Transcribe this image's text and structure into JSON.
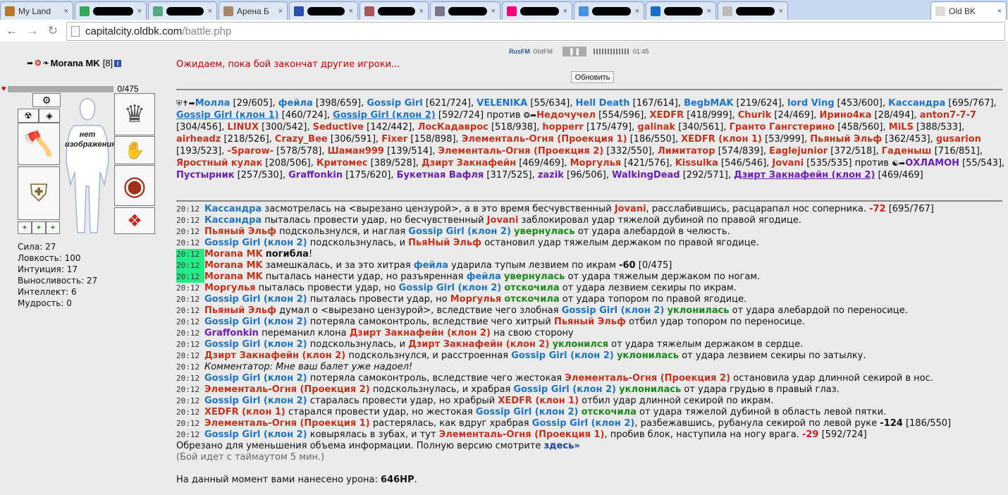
{
  "browser": {
    "tabs": [
      {
        "title": "My Land",
        "redacted": false
      },
      {
        "title": "",
        "redacted": true
      },
      {
        "title": "",
        "redacted": true
      },
      {
        "title": "Арена Б",
        "redacted": false
      },
      {
        "title": "",
        "redacted": true
      },
      {
        "title": "",
        "redacted": true
      },
      {
        "title": "",
        "redacted": true
      },
      {
        "title": "",
        "redacted": true
      },
      {
        "title": "",
        "redacted": true
      },
      {
        "title": "",
        "redacted": true
      },
      {
        "title": "",
        "redacted": true
      },
      {
        "title": "Old BK",
        "redacted": false,
        "active": true
      }
    ],
    "url_host": "capitalcity.oldbk.com",
    "url_path": "/battle.php"
  },
  "character": {
    "name": "Morana MK",
    "level": "[8]",
    "hp": "0/475",
    "no_image": "нет изображения",
    "stats": [
      {
        "label": "Сила:",
        "value": "27"
      },
      {
        "label": "Ловкость:",
        "value": "100"
      },
      {
        "label": "Интуиция:",
        "value": "17"
      },
      {
        "label": "Выносливость:",
        "value": "27"
      },
      {
        "label": "Интеллект:",
        "value": "6"
      },
      {
        "label": "Мудрость:",
        "value": "0"
      }
    ]
  },
  "radio": {
    "rus": "RusFM",
    "old": "OldFM",
    "time": "01:45"
  },
  "battle": {
    "wait_message": "Ожидаем, пока бой закончат другие игроки...",
    "refresh_label": "Обновить",
    "versus": "против"
  },
  "team_blue": [
    [
      "Молла",
      "[29/605]"
    ],
    [
      "фейла",
      "[398/659]"
    ],
    [
      "Gossip Girl",
      "[621/724]"
    ],
    [
      "VELENIKA",
      "[55/634]"
    ],
    [
      "Hell Death",
      "[167/614]"
    ],
    [
      "BegbMAK",
      "[219/624]"
    ],
    [
      "lord Ving",
      "[453/600]"
    ],
    [
      "Кассандра",
      "[695/767]"
    ],
    [
      "Gossip Girl (клон 1)",
      "[460/724]"
    ],
    [
      "Gossip Girl (клон 2)",
      "[592/724]"
    ]
  ],
  "team_red": [
    [
      "Недочучел",
      "[554/596]"
    ],
    [
      "XEDFR",
      "[418/999]"
    ],
    [
      "Churik",
      "[24/469]"
    ],
    [
      "Ирино4ка",
      "[28/494]"
    ],
    [
      "anton7-7-7",
      "[304/456]"
    ],
    [
      "LINUX",
      "[300/542]"
    ],
    [
      "Seductive",
      "[142/442]"
    ],
    [
      "ЛосКадаврос",
      "[518/938]"
    ],
    [
      "hopperr",
      "[175/479]"
    ],
    [
      "galinak",
      "[340/561]"
    ],
    [
      "Гранто Гангстерино",
      "[458/560]"
    ],
    [
      "MiLS",
      "[388/533]"
    ],
    [
      "airheadz",
      "[218/526]"
    ],
    [
      "Crazy_Bee",
      "[306/591]"
    ],
    [
      "Fixer",
      "[158/898]"
    ],
    [
      "Элементаль-Огня (Проекция 1)",
      "[186/550]"
    ],
    [
      "XEDFR (клон 1)",
      "[53/999]"
    ],
    [
      "Пьяный Эльф",
      "[362/453]"
    ],
    [
      "gusarion",
      "[193/523]"
    ],
    [
      "-Sparow-",
      "[578/578]"
    ],
    [
      "Шаман999",
      "[139/514]"
    ],
    [
      "Элементаль-Огня (Проекция 2)",
      "[332/550]"
    ],
    [
      "Лимитатор",
      "[574/839]"
    ],
    [
      "Eaglejunior",
      "[372/518]"
    ],
    [
      "Гаденыш",
      "[716/851]"
    ],
    [
      "Яростный кулак",
      "[208/506]"
    ],
    [
      "Критомес",
      "[389/528]"
    ],
    [
      "Дзирт Закнафейн",
      "[469/469]"
    ],
    [
      "Моргулья",
      "[421/576]"
    ],
    [
      "Kissulka",
      "[546/546]"
    ],
    [
      "Jovani",
      "[535/535]"
    ]
  ],
  "team_purple": [
    [
      "ОХЛАМОН",
      "[55/543]"
    ],
    [
      "Пустырник",
      "[257/530]"
    ],
    [
      "Graffonkin",
      "[175/620]"
    ],
    [
      "Букетная Вафля",
      "[317/525]"
    ],
    [
      "zazik",
      "[96/506]"
    ],
    [
      "WalkingDead",
      "[292/571]"
    ],
    [
      "Дзирт Закнафейн (клон 2)",
      "[469/469]"
    ]
  ],
  "log": [
    {
      "time": "20:12",
      "hl": false,
      "parts": [
        [
          "b",
          "Кассандра"
        ],
        [
          "",
          "засмотрелась на <вырезано цензурой>, а в это время бесчувственный"
        ],
        [
          "r",
          "Jovani"
        ],
        [
          "",
          ", расслабившись, расцарапал нос соперника."
        ],
        [
          "dmg",
          "-72"
        ],
        [
          "",
          "[695/767]"
        ]
      ]
    },
    {
      "time": "20:12",
      "hl": false,
      "parts": [
        [
          "b",
          "Кассандра"
        ],
        [
          "",
          "пыталась провести удар, но бесчувственный"
        ],
        [
          "r",
          "Jovani"
        ],
        [
          "",
          "заблокировал удар тяжелой дубиной по правой ягодице."
        ]
      ]
    },
    {
      "time": "20:12",
      "hl": false,
      "parts": [
        [
          "r",
          "Пьяный Эльф"
        ],
        [
          "",
          "подскользнулся, и наглая"
        ],
        [
          "b",
          "Gossip Girl (клон 2)"
        ],
        [
          "g",
          "увернулась"
        ],
        [
          "",
          "от удара алебардой в челюсть."
        ]
      ]
    },
    {
      "time": "20:12",
      "hl": false,
      "parts": [
        [
          "b",
          "Gossip Girl (клон 2)"
        ],
        [
          "",
          "подскользнулась, и"
        ],
        [
          "r",
          "ПьяНый Эльф"
        ],
        [
          "",
          "остановил удар тяжелым держаком по правой ягодице."
        ]
      ]
    },
    {
      "time": "20:12",
      "hl": true,
      "parts": [
        [
          "r",
          "Morana MK"
        ],
        [
          "k",
          "погибла"
        ],
        [
          "",
          "!"
        ]
      ]
    },
    {
      "time": "20:12",
      "hl": true,
      "parts": [
        [
          "r",
          "Morana MK"
        ],
        [
          "",
          "замешкалась, и за это хитрая"
        ],
        [
          "b",
          "фейла"
        ],
        [
          "",
          "ударила тупым лезвием по икрам"
        ],
        [
          "k",
          "-60"
        ],
        [
          "",
          "[0/475]"
        ]
      ]
    },
    {
      "time": "20:12",
      "hl": true,
      "parts": [
        [
          "r",
          "Morana MK"
        ],
        [
          "",
          "пыталась нанести удар, но разъяренная"
        ],
        [
          "b",
          "фейла"
        ],
        [
          "g",
          "увернулась"
        ],
        [
          "",
          "от удара тяжелым держаком по ногам."
        ]
      ]
    },
    {
      "time": "20:12",
      "hl": false,
      "parts": [
        [
          "r",
          "Моргулья"
        ],
        [
          "",
          "пыталась провести удар, но"
        ],
        [
          "b",
          "Gossip Girl (клон 2)"
        ],
        [
          "g",
          "отскочила"
        ],
        [
          "",
          "от удара лезвием секиры по икрам."
        ]
      ]
    },
    {
      "time": "20:12",
      "hl": false,
      "parts": [
        [
          "b",
          "Gossip Girl (клон 2)"
        ],
        [
          "",
          "пыталась провести удар, но"
        ],
        [
          "r",
          "Моргулья"
        ],
        [
          "g",
          "отскочила"
        ],
        [
          "",
          "от удара топором по правой ягодице."
        ]
      ]
    },
    {
      "time": "20:12",
      "hl": false,
      "parts": [
        [
          "r",
          "Пьяный Эльф"
        ],
        [
          "",
          "думал о <вырезано цензурой>, вследствие чего злобная"
        ],
        [
          "b",
          "Gossip Girl (клон 2)"
        ],
        [
          "g",
          "уклонилась"
        ],
        [
          "",
          "от удара алебардой по переносице."
        ]
      ]
    },
    {
      "time": "20:12",
      "hl": false,
      "parts": [
        [
          "b",
          "Gossip Girl (клон 2)"
        ],
        [
          "",
          "потеряла самоконтроль, вследствие чего хитрый"
        ],
        [
          "r",
          "Пьяный Эльф"
        ],
        [
          "",
          "отбил удар топором по переносице."
        ]
      ]
    },
    {
      "time": "20:12",
      "hl": false,
      "parts": [
        [
          "p",
          "Graffonkin"
        ],
        [
          "",
          "переманил клона"
        ],
        [
          "r",
          "Дзирт Закнафейн (клон 2)"
        ],
        [
          "",
          "на свою сторону"
        ]
      ]
    },
    {
      "time": "20:12",
      "hl": false,
      "parts": [
        [
          "b",
          "Gossip Girl (клон 2)"
        ],
        [
          "",
          "подскользнулась, и"
        ],
        [
          "r",
          "Дзирт Закнафейн (клон 2)"
        ],
        [
          "g",
          "уклонился"
        ],
        [
          "",
          "от удара тяжелым держаком в сердце."
        ]
      ]
    },
    {
      "time": "20:12",
      "hl": false,
      "parts": [
        [
          "r",
          "Дзирт Закнафейн (клон 2)"
        ],
        [
          "",
          "подскользнулся, и расстроенная"
        ],
        [
          "b",
          "Gossip Girl (клон 2)"
        ],
        [
          "g",
          "уклонилась"
        ],
        [
          "",
          "от удара лезвием секиры по затылку."
        ]
      ]
    },
    {
      "time": "20:12",
      "hl": false,
      "parts": [
        [
          "i",
          "Комментатор: Мне ваш балет уже надоел!"
        ]
      ]
    },
    {
      "time": "20:12",
      "hl": false,
      "parts": [
        [
          "b",
          "Gossip Girl (клон 2)"
        ],
        [
          "",
          "потеряла самоконтроль, вследствие чего жестокая"
        ],
        [
          "r",
          "Элементаль-Огня (Проекция 2)"
        ],
        [
          "",
          "остановила удар длинной секирой в нос."
        ]
      ]
    },
    {
      "time": "20:12",
      "hl": false,
      "parts": [
        [
          "r",
          "Элементаль-Огня (Проекция 2)"
        ],
        [
          "",
          "подскользнулась, и храбрая"
        ],
        [
          "b",
          "Gossip Girl (клон 2)"
        ],
        [
          "g",
          "уклонилась"
        ],
        [
          "",
          "от удара грудью в правый глаз."
        ]
      ]
    },
    {
      "time": "20:12",
      "hl": false,
      "parts": [
        [
          "b",
          "Gossip Girl (клон 2)"
        ],
        [
          "",
          "старалась провести удар, но храбрый"
        ],
        [
          "r",
          "XEDFR (клон 1)"
        ],
        [
          "",
          "отбил удар длинной секирой по икрам."
        ]
      ]
    },
    {
      "time": "20:12",
      "hl": false,
      "parts": [
        [
          "r",
          "XEDFR (клон 1)"
        ],
        [
          "",
          "старался провести удар, но жестокая"
        ],
        [
          "b",
          "Gossip Girl (клон 2)"
        ],
        [
          "g",
          "отскочила"
        ],
        [
          "",
          "от удара тяжелой дубиной в область левой пятки."
        ]
      ]
    },
    {
      "time": "20:12",
      "hl": false,
      "parts": [
        [
          "r",
          "Элементаль-Огня (Проекция 1)"
        ],
        [
          "",
          "растерялась, как вдруг храбрая"
        ],
        [
          "b",
          "Gossip Girl (клон 2)"
        ],
        [
          "",
          ", разбежавшись, рубанула секирой по левой руке"
        ],
        [
          "k",
          "-124"
        ],
        [
          "",
          "[186/550]"
        ]
      ]
    },
    {
      "time": "20:12",
      "hl": false,
      "parts": [
        [
          "b",
          "Gossip Girl (клон 2)"
        ],
        [
          "",
          "ковырялась в зубах, и тут"
        ],
        [
          "r",
          "Элементаль-Огня (Проекция 1)"
        ],
        [
          "",
          ", пробив блок, наступила на ногу врага."
        ],
        [
          "dmg",
          "-29"
        ],
        [
          "",
          "[592/724]"
        ]
      ]
    }
  ],
  "footer": {
    "truncated": "Обрезано для уменьшения объема информации. Полную версию смотрите",
    "link": "здесь»",
    "timeout": "(Бой идет с таймаутом 5 мин.)",
    "damage_label": "На данный момент вами нанесено урона:",
    "damage_value": "646HP"
  }
}
